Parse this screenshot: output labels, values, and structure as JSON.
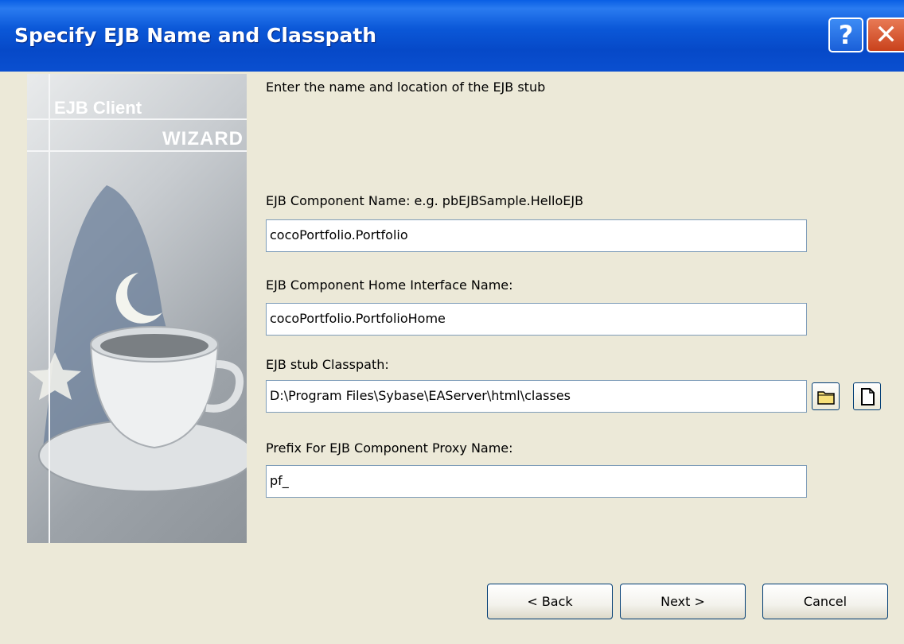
{
  "window": {
    "title": "Specify EJB Name and Classpath",
    "help_glyph": "?",
    "close_glyph": "✕"
  },
  "banner": {
    "line1": "EJB Client",
    "line2": "WIZARD"
  },
  "description": "Enter the name and location of the EJB stub",
  "fields": {
    "component_name": {
      "label": "EJB Component Name: e.g. pbEJBSample.HelloEJB",
      "value": "cocoPortfolio.Portfolio"
    },
    "home_interface": {
      "label": "EJB Component Home Interface Name:",
      "value": "cocoPortfolio.PortfolioHome"
    },
    "stub_classpath": {
      "label": "EJB stub Classpath:",
      "value": "D:\\Program Files\\Sybase\\EAServer\\html\\classes"
    },
    "proxy_prefix": {
      "label": "Prefix For EJB Component Proxy Name:",
      "value": "pf_"
    }
  },
  "classpath_buttons": {
    "browse_icon": "folder-icon",
    "new_icon": "document-icon"
  },
  "buttons": {
    "back": "< Back",
    "next": "Next >",
    "cancel": "Cancel"
  },
  "colors": {
    "titlebar": "#0a4fd0",
    "face": "#ece9d8",
    "close": "#c9421c"
  }
}
